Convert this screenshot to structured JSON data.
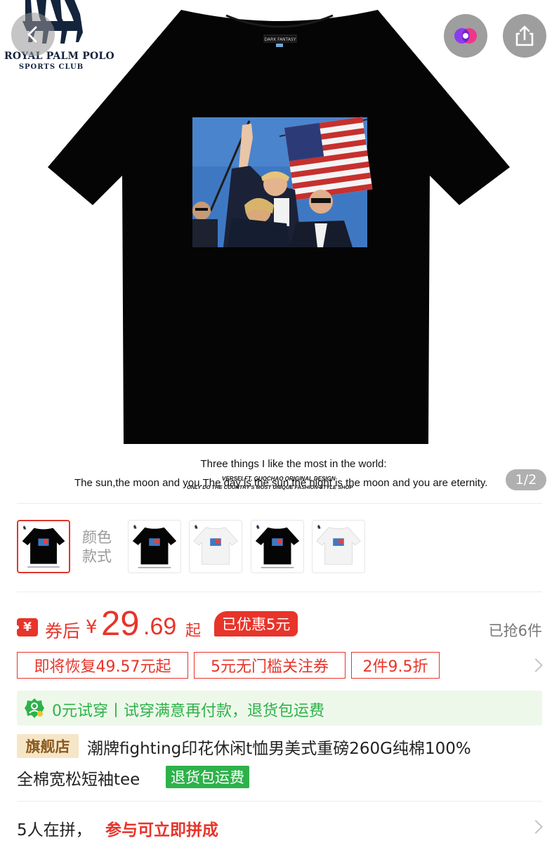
{
  "brand": {
    "line1": "ROYAL PALM POLO",
    "line2": "SPORTS CLUB"
  },
  "header": {
    "back_icon": "chevron-left-icon",
    "favorite_icon": "app-logo-icon",
    "share_icon": "share-icon"
  },
  "gallery": {
    "shirt_color": "#050505",
    "slogan_line1": "Three things I like the most in the world:",
    "slogan_line2": "The sun,the moon and you.The day is the sun,the night is the moon and you are eternity.",
    "overprint_line1": "VERSELFT, GUOCHAO ORIGINAL DESIGN",
    "overprint_line2": "ONLY DO THE COUNTRY'S MOST UNIQUE FASHION STYLE SHOP",
    "page_indicator": "1/2"
  },
  "variants": {
    "label": "颜色款式",
    "items": [
      {
        "color": "black",
        "selected": true
      },
      {
        "color": "black",
        "selected": false
      },
      {
        "color": "white",
        "selected": false
      },
      {
        "color": "black",
        "selected": false
      },
      {
        "color": "white",
        "selected": false
      }
    ]
  },
  "price": {
    "coupon_icon": "¥",
    "prefix": "券后",
    "currency": "¥",
    "integer": "29",
    "decimal": ".69",
    "suffix": "起",
    "discount_badge": "已优惠5元",
    "sold": "已抢6件"
  },
  "promotions": [
    "即将恢复49.57元起",
    "5元无门槛关注券",
    "2件9.5折"
  ],
  "trial": {
    "text": "0元试穿丨试穿满意再付款，退货包运费"
  },
  "product": {
    "store_badge": "旗舰店",
    "title_line1": "潮牌fighting印花休闲t恤男美式重磅260G纯棉100%",
    "title_line2": "全棉宽松短袖tee",
    "return_badge": "退货包运费"
  },
  "group_buy": {
    "count": "5人在拼，",
    "cta": "参与可立即拼成"
  },
  "colors": {
    "accent_red": "#e8342a",
    "trial_green": "#2db24a",
    "trial_bg": "#eef8ea",
    "store_badge_bg": "#f6e6c8"
  }
}
